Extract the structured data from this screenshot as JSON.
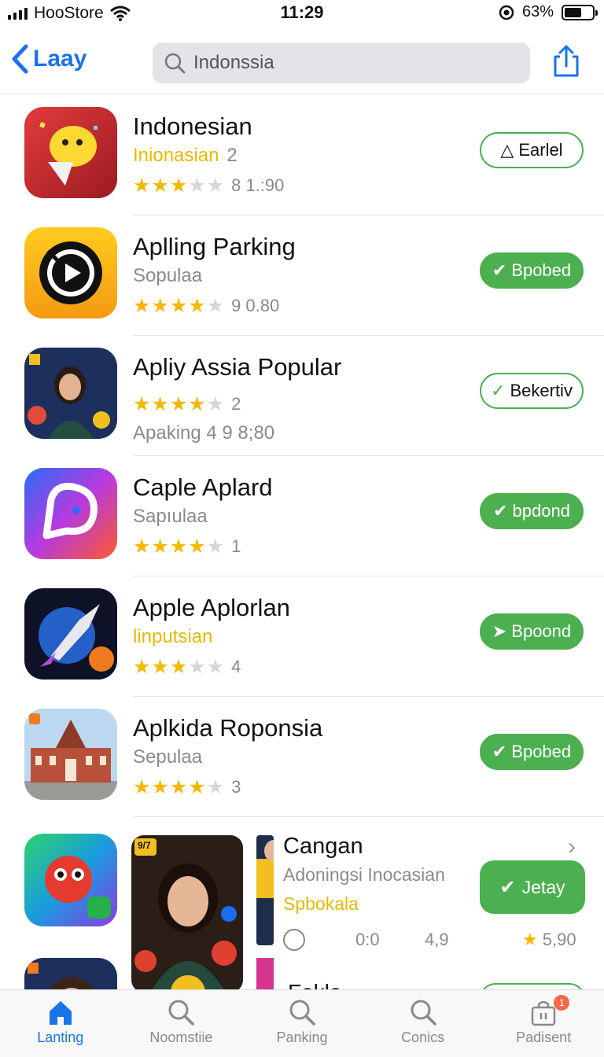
{
  "status_bar": {
    "carrier": "HooStore",
    "time": "11:29",
    "battery_pct": "63%",
    "battery_level": 0.63
  },
  "nav": {
    "back_label": "Laay",
    "search_value": "Indonssia"
  },
  "apps": [
    {
      "title": "Indonesian",
      "subtitle": "Inionasian",
      "subtitle_extra": "2",
      "subtitle_color": "yellow",
      "stars": 3,
      "rating_text": "8 1.:90",
      "button": "Earlel",
      "button_style": "outline",
      "button_icon": "triangle-icon"
    },
    {
      "title": "Aplling Parking",
      "subtitle": "Sopulaa",
      "subtitle_extra": "",
      "subtitle_color": "gray",
      "stars": 4,
      "rating_text": "9 0.80",
      "button": "Bpobed",
      "button_style": "filled",
      "button_icon": "check-icon"
    },
    {
      "title": "Apliy Assia Popular",
      "subtitle": "",
      "subtitle_extra": "",
      "subtitle_color": "gray",
      "stars": 4,
      "rating_text": "2",
      "extra_line": "Apaking  4 9 8;80",
      "button": "Bekertiv",
      "button_style": "outline",
      "button_icon": "check-icon"
    },
    {
      "title": "Caple Aplard",
      "subtitle": "Sapıulaa",
      "subtitle_extra": "",
      "subtitle_color": "gray",
      "stars": 4,
      "rating_text": "1",
      "button": "bpdond",
      "button_style": "filled",
      "button_icon": "check-icon"
    },
    {
      "title": "Apple Aplorlan",
      "subtitle": "linputsian",
      "subtitle_extra": "",
      "subtitle_color": "yellow",
      "stars": 3,
      "rating_text": "4",
      "button": "Bpoond",
      "button_style": "filled",
      "button_icon": "send-icon"
    },
    {
      "title": "Aplkida Roponsia",
      "subtitle": "Sepulaa",
      "subtitle_extra": "",
      "subtitle_color": "gray",
      "stars": 4,
      "rating_text": "3",
      "button": "Bpobed",
      "button_style": "filled",
      "button_icon": "check-icon"
    }
  ],
  "featured": {
    "badge_text": "9/7",
    "title": "Cangan",
    "subtitle": "Adoningsi Inocasian",
    "category": "Spbokala",
    "button": "Jetay",
    "meta_time": "0:0",
    "meta_score": "4,9",
    "meta_rating": "5,90",
    "next_title": "Fokla"
  },
  "tabs": [
    {
      "label": "Lanting",
      "icon": "home-icon",
      "active": true
    },
    {
      "label": "Noomstiie",
      "icon": "search-icon",
      "active": false
    },
    {
      "label": "Panking",
      "icon": "search-icon",
      "active": false
    },
    {
      "label": "Conics",
      "icon": "search-icon",
      "active": false
    },
    {
      "label": "Padisent",
      "icon": "bag-icon",
      "active": false,
      "badge": "1"
    }
  ],
  "colors": {
    "accent": "#1a73e8",
    "green": "#4caf50",
    "star": "#f5b800",
    "yellow_text": "#e6b800"
  }
}
